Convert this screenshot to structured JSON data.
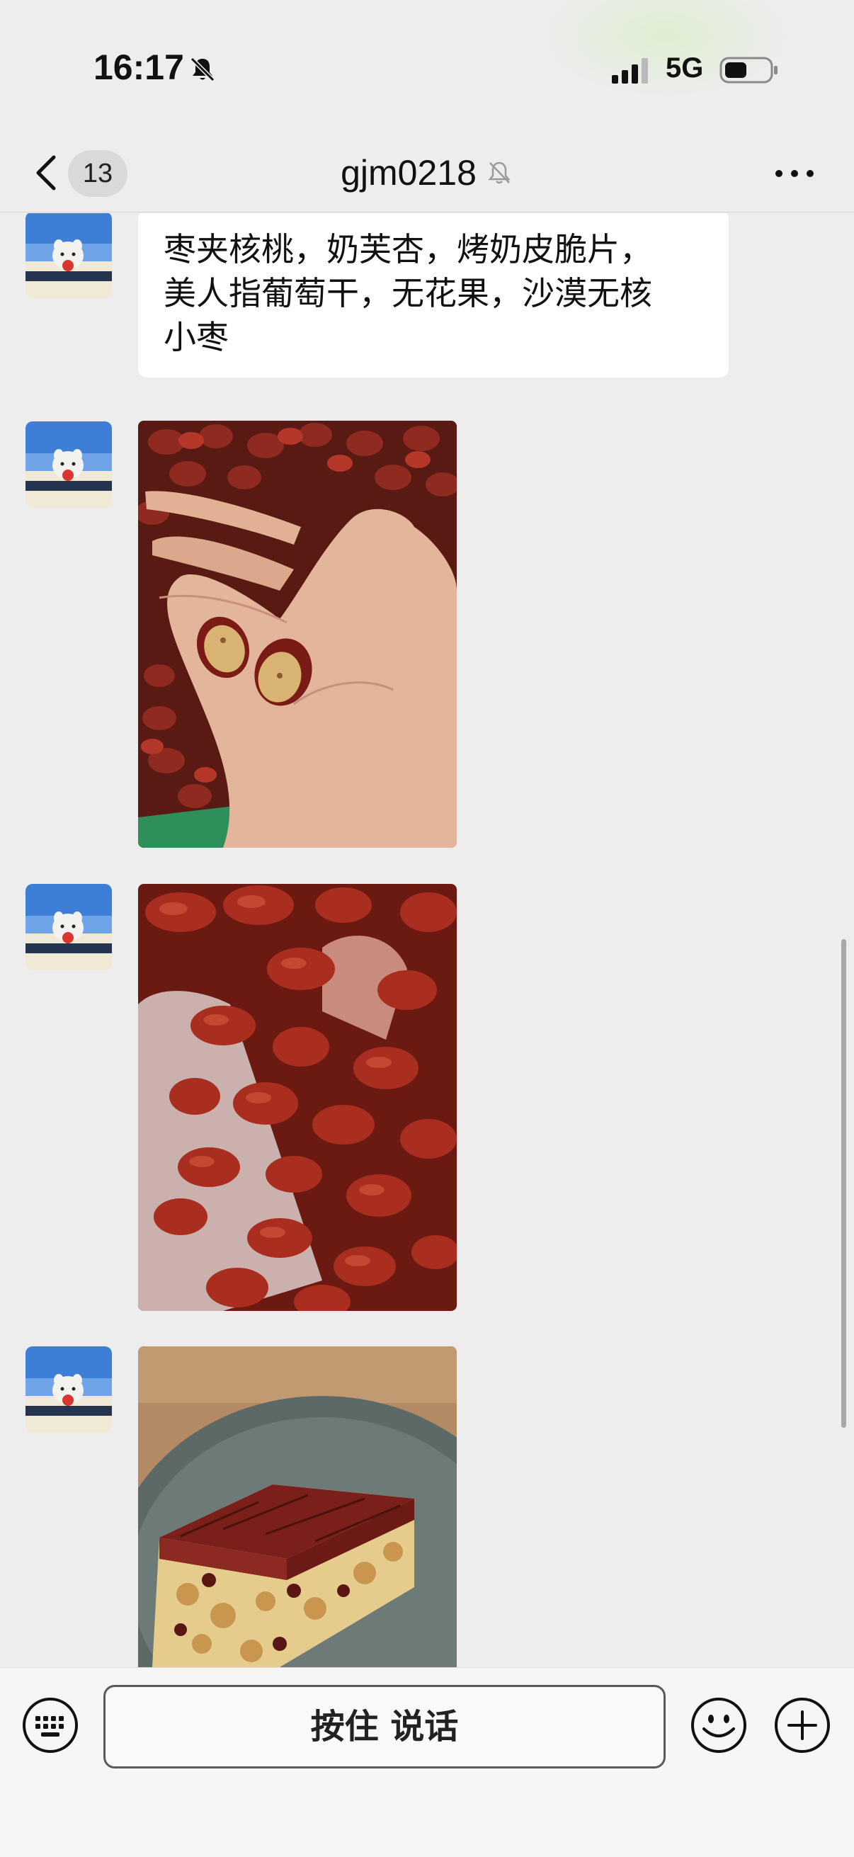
{
  "status_bar": {
    "time": "16:17",
    "network": "5G",
    "icons": [
      "bell-slash-icon",
      "signal-icon",
      "battery-icon"
    ]
  },
  "nav": {
    "unread_count": "13",
    "title": "gjm0218",
    "icons": [
      "chevron-left-icon",
      "muted-bell-icon",
      "more-icon"
    ]
  },
  "messages": [
    {
      "type": "text",
      "text_lines": [
        "枣夹核桃，奶芙杏，烤奶皮脆片，",
        "美人指葡萄干，无花果，沙漠无核",
        "小枣"
      ]
    },
    {
      "type": "image",
      "subject": "hand-holding-split-red-date-photo"
    },
    {
      "type": "image",
      "subject": "hand-holding-red-dates-photo"
    },
    {
      "type": "image",
      "subject": "date-walnut-cake-photo"
    }
  ],
  "input_bar": {
    "hold_to_talk_label": "按住 说话",
    "icons": [
      "keyboard-icon",
      "emoji-icon",
      "plus-icon"
    ]
  },
  "colors": {
    "background": "#ededed",
    "bubble": "#ffffff",
    "input_bar": "#f6f6f6"
  }
}
